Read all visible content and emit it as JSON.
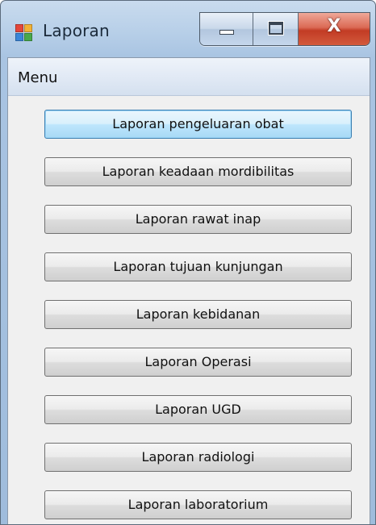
{
  "window": {
    "title": "Laporan",
    "icon": "app-window-icon",
    "controls": {
      "minimize_icon": "minimize-icon",
      "maximize_icon": "maximize-icon",
      "close_glyph": "X"
    },
    "colors": {
      "close_button": "#c23b24",
      "focus_border": "#3c7fb1"
    }
  },
  "menubar": {
    "items": [
      {
        "label": "Menu"
      }
    ]
  },
  "buttons": [
    {
      "label": "Laporan pengeluaran obat",
      "focused": true
    },
    {
      "label": "Laporan keadaan mordibilitas",
      "focused": false
    },
    {
      "label": "Laporan rawat inap",
      "focused": false
    },
    {
      "label": "Laporan tujuan kunjungan",
      "focused": false
    },
    {
      "label": "Laporan kebidanan",
      "focused": false
    },
    {
      "label": "Laporan Operasi",
      "focused": false
    },
    {
      "label": "Laporan UGD",
      "focused": false
    },
    {
      "label": "Laporan radiologi",
      "focused": false
    },
    {
      "label": "Laporan laboratorium",
      "focused": false
    }
  ]
}
